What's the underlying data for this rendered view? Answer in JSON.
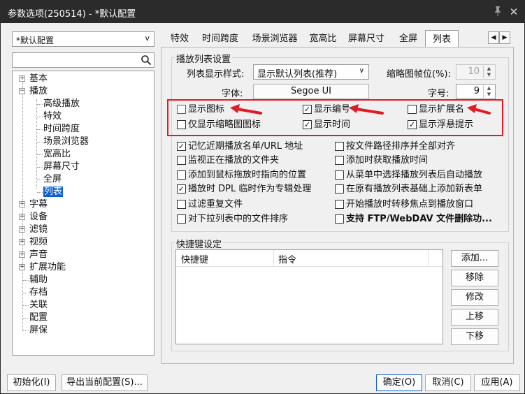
{
  "window": {
    "title": "参数选项(250514) - *默认配置"
  },
  "left": {
    "profile": "*默认配置",
    "tree": [
      {
        "label": "基本",
        "expander": "+"
      },
      {
        "label": "播放",
        "expander": "−"
      },
      {
        "label": "高级播放"
      },
      {
        "label": "特效"
      },
      {
        "label": "时间跨度"
      },
      {
        "label": "场景浏览器"
      },
      {
        "label": "宽高比"
      },
      {
        "label": "屏幕尺寸"
      },
      {
        "label": "全屏"
      },
      {
        "label": "列表",
        "selected": true
      },
      {
        "label": "字幕",
        "expander": "+"
      },
      {
        "label": "设备",
        "expander": "+"
      },
      {
        "label": "滤镜",
        "expander": "+"
      },
      {
        "label": "视频",
        "expander": "+"
      },
      {
        "label": "声音",
        "expander": "+"
      },
      {
        "label": "扩展功能",
        "expander": "+"
      },
      {
        "label": "辅助"
      },
      {
        "label": "存档"
      },
      {
        "label": "关联"
      },
      {
        "label": "配置"
      },
      {
        "label": "屏保"
      }
    ]
  },
  "tabs": [
    "特效",
    "时间跨度",
    "场景浏览器",
    "宽高比",
    "屏幕尺寸",
    "全屏",
    "列表"
  ],
  "tab_scroll": {
    "left": "◀",
    "right": "▶"
  },
  "playlist_group": {
    "title": "播放列表设置",
    "style_label": "列表显示样式:",
    "style_value": "显示默认列表(推荐)",
    "thumb_label": "缩略图帧位(%):",
    "thumb_value": "10",
    "font_label": "字体:",
    "font_value": "Segoe UI",
    "size_label": "字号:",
    "size_value": "9"
  },
  "highlighted_options": [
    {
      "label": "显示图标",
      "checked": false
    },
    {
      "label": "显示编号",
      "checked": true
    },
    {
      "label": "显示扩展名",
      "checked": false
    },
    {
      "label": "仅显示缩略图图标",
      "checked": false
    },
    {
      "label": "显示时间",
      "checked": true
    },
    {
      "label": "显示浮悬提示",
      "checked": true
    }
  ],
  "options": [
    {
      "label": "记忆近期播放名单/URL 地址",
      "checked": true
    },
    {
      "label": "按文件路径排序并全部对齐",
      "checked": false
    },
    {
      "label": "监视正在播放的文件夹",
      "checked": false
    },
    {
      "label": "添加时获取播放时间",
      "checked": false
    },
    {
      "label": "添加到鼠标拖放时指向的位置",
      "checked": false
    },
    {
      "label": "从菜单中选择播放列表后自动播放",
      "checked": false
    },
    {
      "label": "播放时 DPL 临时作为专辑处理",
      "checked": true
    },
    {
      "label": "在原有播放列表基础上添加新表单",
      "checked": false
    },
    {
      "label": "过滤重复文件",
      "checked": false
    },
    {
      "label": "开始播放时转移焦点到播放窗口",
      "checked": false
    },
    {
      "label": "对下拉列表中的文件排序",
      "checked": false
    },
    {
      "label": "支持 FTP/WebDAV 文件删除功...",
      "checked": false,
      "bold": true
    }
  ],
  "hotkey_group": {
    "title": "快捷键设定",
    "col_key": "快捷键",
    "col_cmd": "指令",
    "buttons": [
      "添加...",
      "移除",
      "修改",
      "上移",
      "下移"
    ]
  },
  "footer": {
    "reset": "初始化(I)",
    "export": "导出当前配置(S)...",
    "ok": "确定(O)",
    "cancel": "取消(C)",
    "apply": "应用(A)"
  },
  "colors": {
    "highlight_red": "#e01b24",
    "selection_blue": "#0b5fcf",
    "titlebar": "#2b2b2b"
  }
}
